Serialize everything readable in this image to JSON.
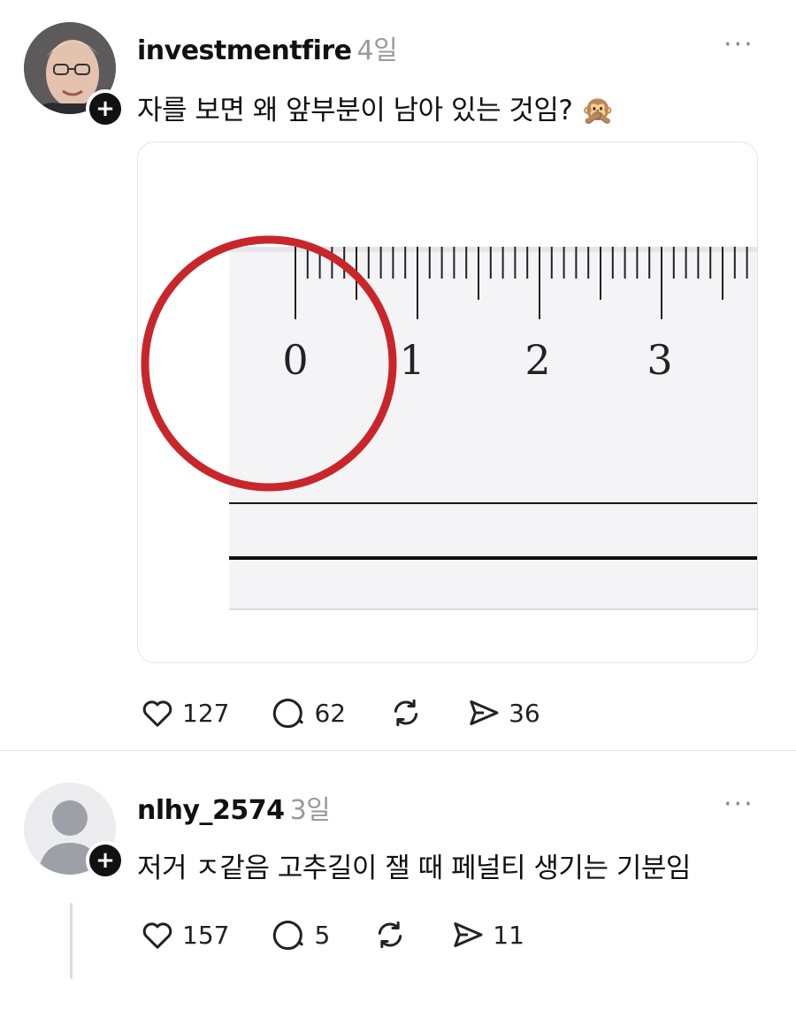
{
  "posts": [
    {
      "username": "investmentfire",
      "time": "4일",
      "text": "자를 보면 왜 앞부분이 남아 있는 것임?",
      "emoji": "🙊",
      "more_label": "···",
      "ruler_labels": [
        "0",
        "1",
        "2",
        "3"
      ],
      "likes": "127",
      "comments": "62",
      "shares": "36"
    },
    {
      "username": "nlhy_2574",
      "time": "3일",
      "text": "저거 ㅈ같음 고추길이 잴 때 페널티 생기는 기분임",
      "more_label": "···",
      "likes": "157",
      "comments": "5",
      "shares": "11"
    }
  ],
  "icons": {
    "plus": "+",
    "like": "heart-icon",
    "comment": "comment-icon",
    "repost": "repost-icon",
    "share": "share-icon"
  },
  "colors": {
    "circle_annotation": "#c8262b",
    "muted_text": "#9a9a9a"
  }
}
